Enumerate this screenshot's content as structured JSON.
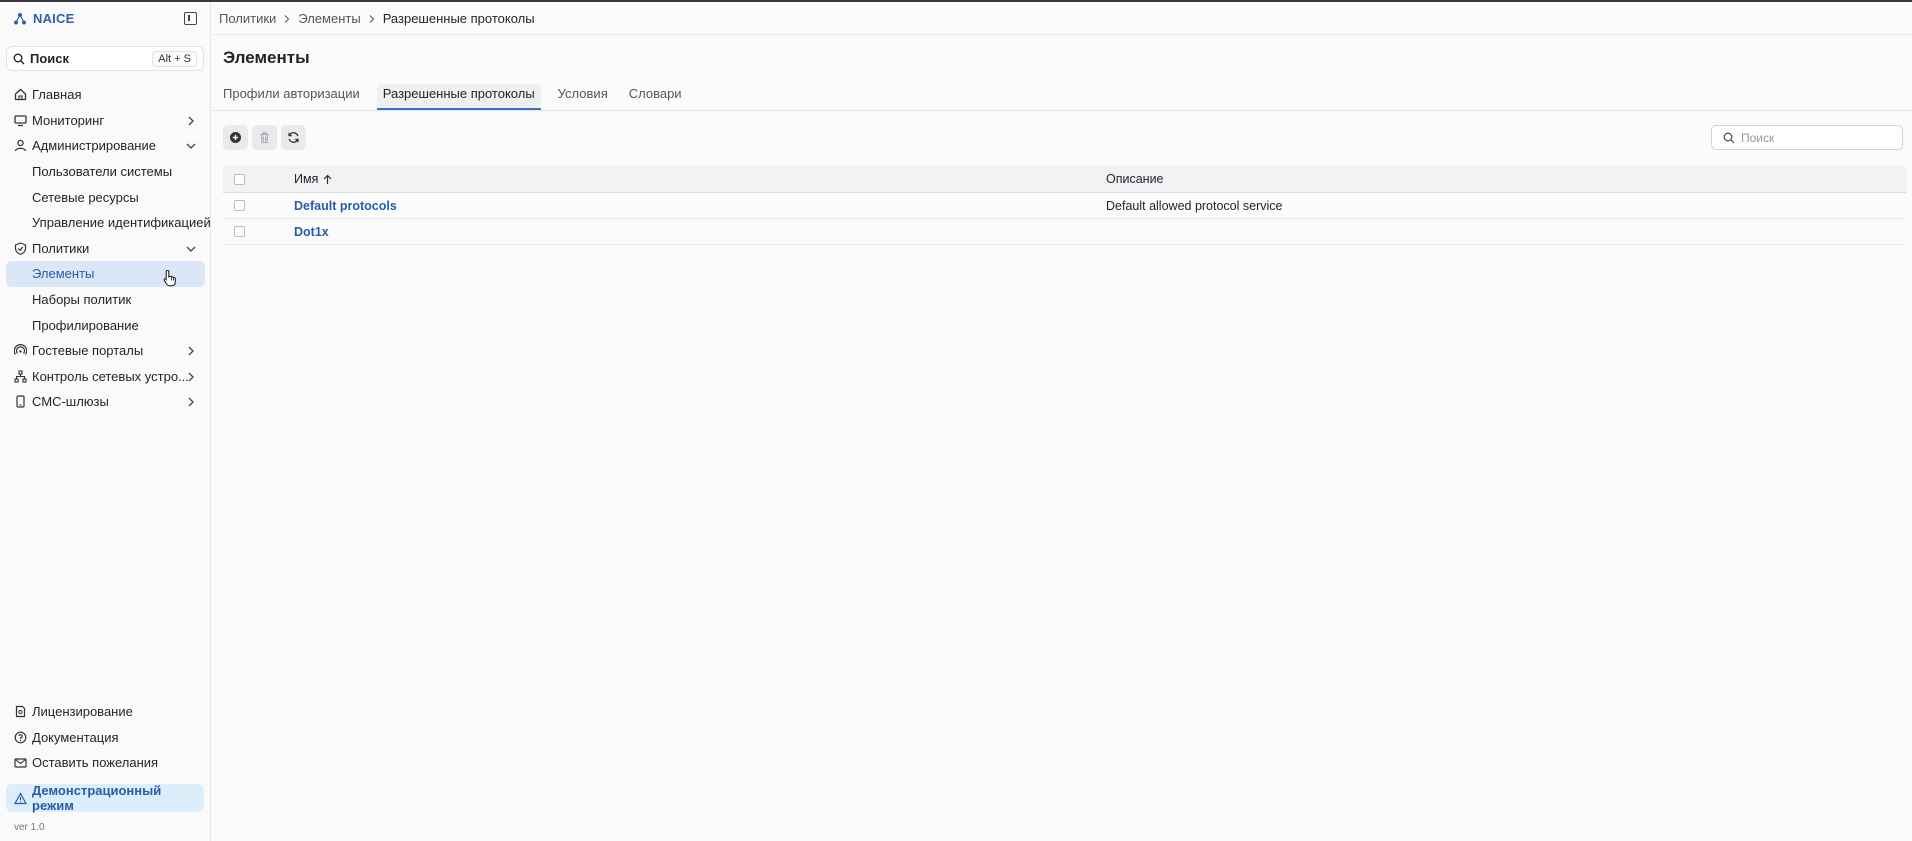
{
  "app": {
    "name": "NAICE",
    "version": "ver 1.0"
  },
  "sidebar": {
    "search": {
      "label": "Поиск",
      "shortcut": "Alt + S"
    },
    "items": [
      {
        "label": "Главная",
        "icon": "home-icon"
      },
      {
        "label": "Мониторинг",
        "icon": "monitor-icon"
      },
      {
        "label": "Администрирование",
        "icon": "user-icon"
      },
      {
        "label": "Пользователи системы"
      },
      {
        "label": "Сетевые ресурсы"
      },
      {
        "label": "Управление идентификацией"
      },
      {
        "label": "Политики",
        "icon": "shield-icon"
      },
      {
        "label": "Элементы"
      },
      {
        "label": "Наборы политик"
      },
      {
        "label": "Профилирование"
      },
      {
        "label": "Гостевые порталы",
        "icon": "wifi-icon"
      },
      {
        "label": "Контроль сетевых устро...",
        "icon": "network-icon"
      },
      {
        "label": "СМС-шлюзы",
        "icon": "phone-icon"
      }
    ],
    "bottom": [
      {
        "label": "Лицензирование",
        "icon": "license-icon"
      },
      {
        "label": "Документация",
        "icon": "help-icon"
      },
      {
        "label": "Оставить пожелания",
        "icon": "mail-icon"
      }
    ],
    "demo": "Демонстрационный режим"
  },
  "breadcrumb": [
    "Политики",
    "Элементы",
    "Разрешенные протоколы"
  ],
  "page": {
    "title": "Элементы",
    "tabs": [
      "Профили авторизации",
      "Разрешенные протоколы",
      "Условия",
      "Словари"
    ]
  },
  "table": {
    "search_placeholder": "Поиск",
    "columns": {
      "name": "Имя",
      "description": "Описание"
    },
    "rows": [
      {
        "name": "Default protocols",
        "description": "Default allowed protocol service"
      },
      {
        "name": "Dot1x",
        "description": ""
      }
    ]
  },
  "colors": {
    "accent": "#2a5bab",
    "active_bg": "#dbe6f7",
    "demo_bg": "#dbeefa"
  }
}
